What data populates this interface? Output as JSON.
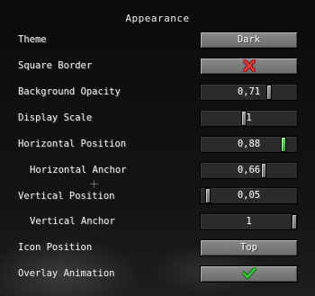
{
  "screen": {
    "title": "Appearance"
  },
  "settings": {
    "theme": {
      "label": "Theme",
      "value": "Dark"
    },
    "square_border": {
      "label": "Square Border",
      "state": "off",
      "icon": "red-x-icon",
      "icon_color": "#e23a3a"
    },
    "background_opacity": {
      "label": "Background Opacity",
      "value": "0,71",
      "fraction": 0.71
    },
    "display_scale": {
      "label": "Display Scale",
      "value": "1",
      "fraction": 0.45
    },
    "horizontal_position": {
      "label": "Horizontal Position",
      "value": "0,88",
      "fraction": 0.88,
      "highlight_color": "#4ccc4c"
    },
    "horizontal_anchor": {
      "label": "Horizontal Anchor",
      "value": "0,66",
      "fraction": 0.66
    },
    "vertical_position": {
      "label": "Vertical Position",
      "value": "0,05",
      "fraction": 0.05
    },
    "vertical_anchor": {
      "label": "Vertical Anchor",
      "value": "1",
      "fraction": 1.0
    },
    "icon_position": {
      "label": "Icon Position",
      "value": "Top"
    },
    "overlay_animation": {
      "label": "Overlay Animation",
      "state": "on",
      "icon": "green-check-icon",
      "icon_color": "#3cc43c"
    }
  }
}
